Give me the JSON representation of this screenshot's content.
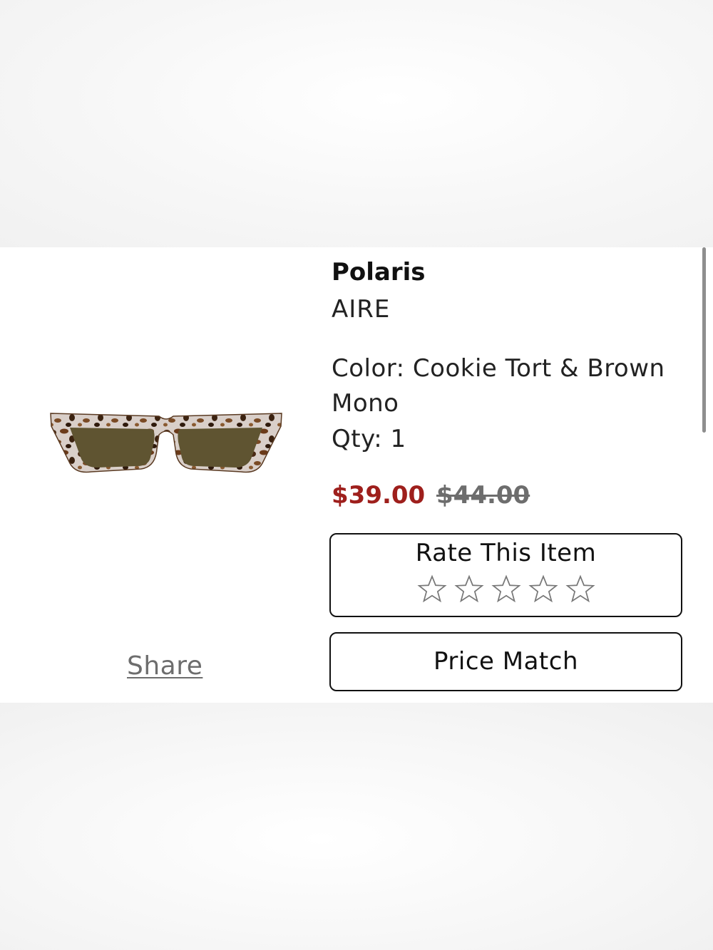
{
  "product": {
    "brand": "Polaris",
    "name": "AIRE",
    "color_text": "Color: Cookie Tort & Brown Mono",
    "qty_text": "Qty: 1",
    "image_icon": "sunglasses-image"
  },
  "pricing": {
    "sale_price": "$39.00",
    "original_price": "$44.00",
    "sale_color": "#9e1f1c",
    "original_color": "#6d6d6d"
  },
  "rating": {
    "title": "Rate This Item",
    "star_count": 5,
    "current_rating": 0,
    "star_icon": "star-outline-icon"
  },
  "actions": {
    "price_match_label": "Price Match",
    "share_label": "Share"
  }
}
